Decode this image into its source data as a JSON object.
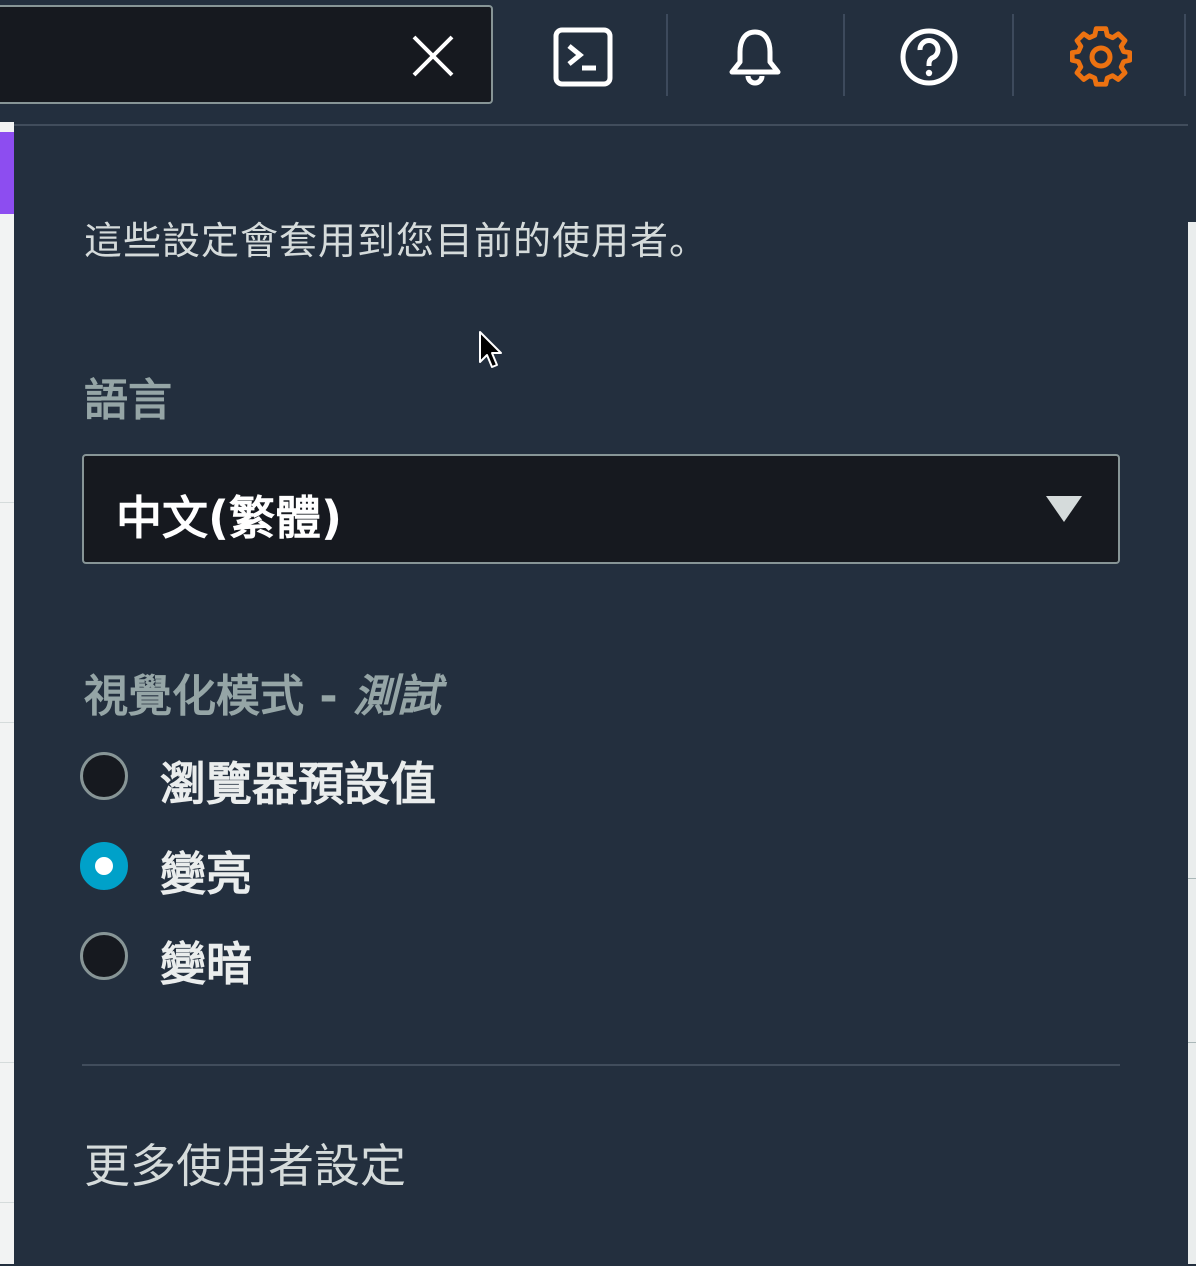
{
  "topbar": {
    "search_value": "",
    "icons": [
      "close-icon",
      "cloudshell-icon",
      "bell-icon",
      "help-icon",
      "gear-icon"
    ],
    "active_icon_color": "#ec7211"
  },
  "settings_panel": {
    "description": "這些設定會套用到您目前的使用者。",
    "language": {
      "label": "語言",
      "selected": "中文(繁體)"
    },
    "visual_mode": {
      "label": "視覺化模式 - ",
      "label_suffix": "測試",
      "options": [
        {
          "label": "瀏覽器預設值",
          "checked": false
        },
        {
          "label": "變亮",
          "checked": true
        },
        {
          "label": "變暗",
          "checked": false
        }
      ]
    },
    "more_settings": "更多使用者設定"
  },
  "colors": {
    "nav_bg": "#232f3e",
    "input_bg": "#16191f",
    "radio_checked": "#00a1c9"
  }
}
